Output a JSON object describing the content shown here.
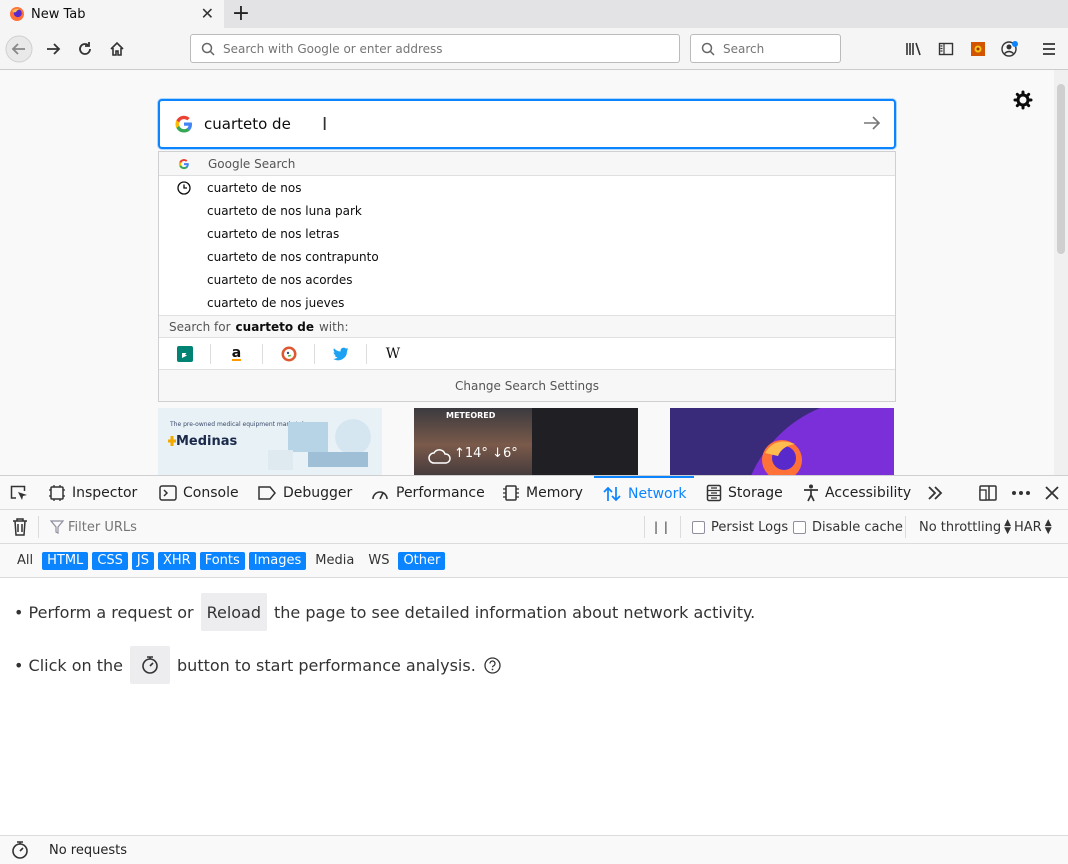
{
  "tab": {
    "title": "New Tab",
    "new_tab_label": "+"
  },
  "nav": {
    "url_placeholder": "Search with Google or enter address",
    "search_placeholder": "Search"
  },
  "newtab_page": {
    "search_query": "cuarteto de",
    "dropdown": {
      "header": "Google Search",
      "suggestions": [
        "cuarteto de nos",
        "cuarteto de nos luna park",
        "cuarteto de nos letras",
        "cuarteto de nos contrapunto",
        "cuarteto de nos acordes",
        "cuarteto de nos jueves"
      ],
      "search_for_prefix": "Search for",
      "search_for_term": "cuarteto de",
      "search_for_suffix": "with:",
      "engines": [
        "bing",
        "amazon",
        "duckduckgo",
        "twitter",
        "wikipedia"
      ],
      "wikipedia_glyph": "W",
      "amazon_glyph": "a",
      "change_settings": "Change Search Settings"
    },
    "tiles": {
      "tile1_tagline": "The pre-owned medical equipment marketplace",
      "tile1_brand": "Medinas",
      "tile2_brand": "METEORED",
      "tile2_temps": "↑14° ↓6°"
    }
  },
  "devtools": {
    "tabs": [
      "Inspector",
      "Console",
      "Debugger",
      "Performance",
      "Memory",
      "Network",
      "Storage",
      "Accessibility"
    ],
    "active_tab": "Network",
    "filter_placeholder": "Filter URLs",
    "pause_label": "| |",
    "persist_logs": "Persist Logs",
    "disable_cache": "Disable cache",
    "throttling": "No throttling",
    "har": "HAR",
    "types": [
      {
        "label": "All",
        "active": false
      },
      {
        "label": "HTML",
        "active": true
      },
      {
        "label": "CSS",
        "active": true
      },
      {
        "label": "JS",
        "active": true
      },
      {
        "label": "XHR",
        "active": true
      },
      {
        "label": "Fonts",
        "active": true
      },
      {
        "label": "Images",
        "active": true
      },
      {
        "label": "Media",
        "active": false
      },
      {
        "label": "WS",
        "active": false
      },
      {
        "label": "Other",
        "active": true
      }
    ],
    "panel": {
      "line1_prefix": "• Perform a request or",
      "reload_label": "Reload",
      "line1_suffix": "the page to see detailed information about network activity.",
      "line2_prefix": "• Click on the",
      "line2_suffix": "button to start performance analysis."
    },
    "status": "No requests"
  },
  "colors": {
    "accent": "#0a84ff",
    "toolbar": "#f5f5f5",
    "tabbar": "#e3e3e5"
  }
}
